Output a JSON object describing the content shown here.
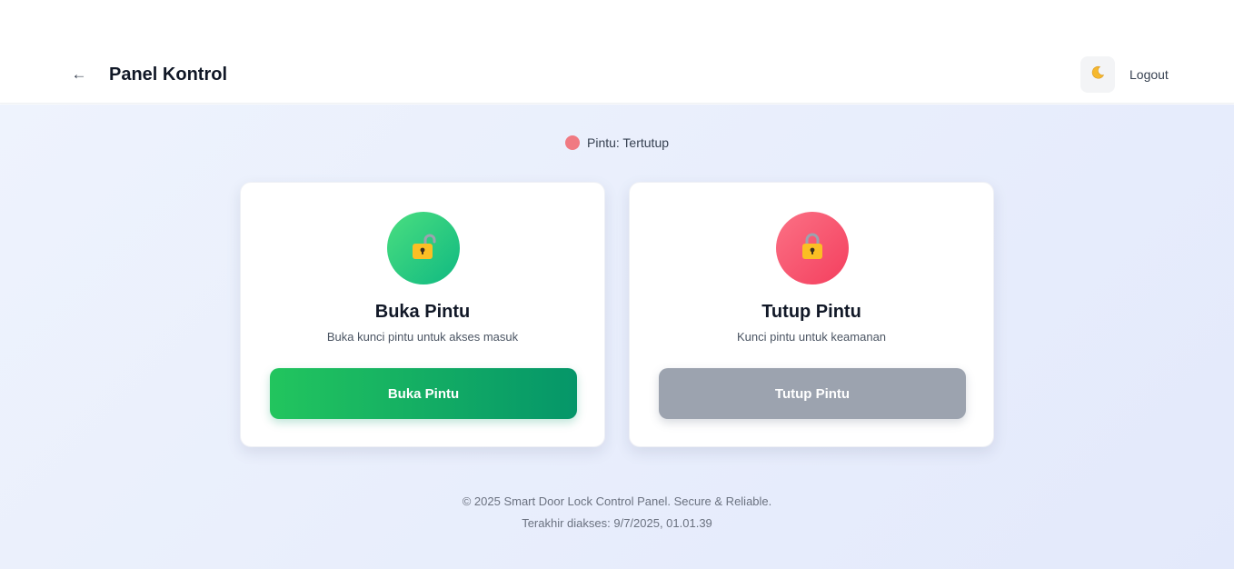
{
  "header": {
    "back_icon": "arrow-left-icon",
    "back_glyph": "←",
    "title": "Panel Kontrol",
    "theme_icon": "moon-icon",
    "theme_glyph": "🌙",
    "logout_label": "Logout"
  },
  "status": {
    "label": "Pintu: Tertutup",
    "dot_color": "#f07a82"
  },
  "cards": {
    "open": {
      "icon": "unlocked-padlock-icon",
      "title": "Buka Pintu",
      "description": "Buka kunci pintu untuk akses masuk",
      "button_label": "Buka Pintu",
      "accent": "#10b981"
    },
    "close": {
      "icon": "locked-padlock-icon",
      "title": "Tutup Pintu",
      "description": "Kunci pintu untuk keamanan",
      "button_label": "Tutup Pintu",
      "accent": "#f43f5e",
      "button_disabled": true
    }
  },
  "footer": {
    "copyright": "© 2025 Smart Door Lock Control Panel. Secure & Reliable.",
    "last_access": "Terakhir diakses: 9/7/2025, 01.01.39"
  }
}
